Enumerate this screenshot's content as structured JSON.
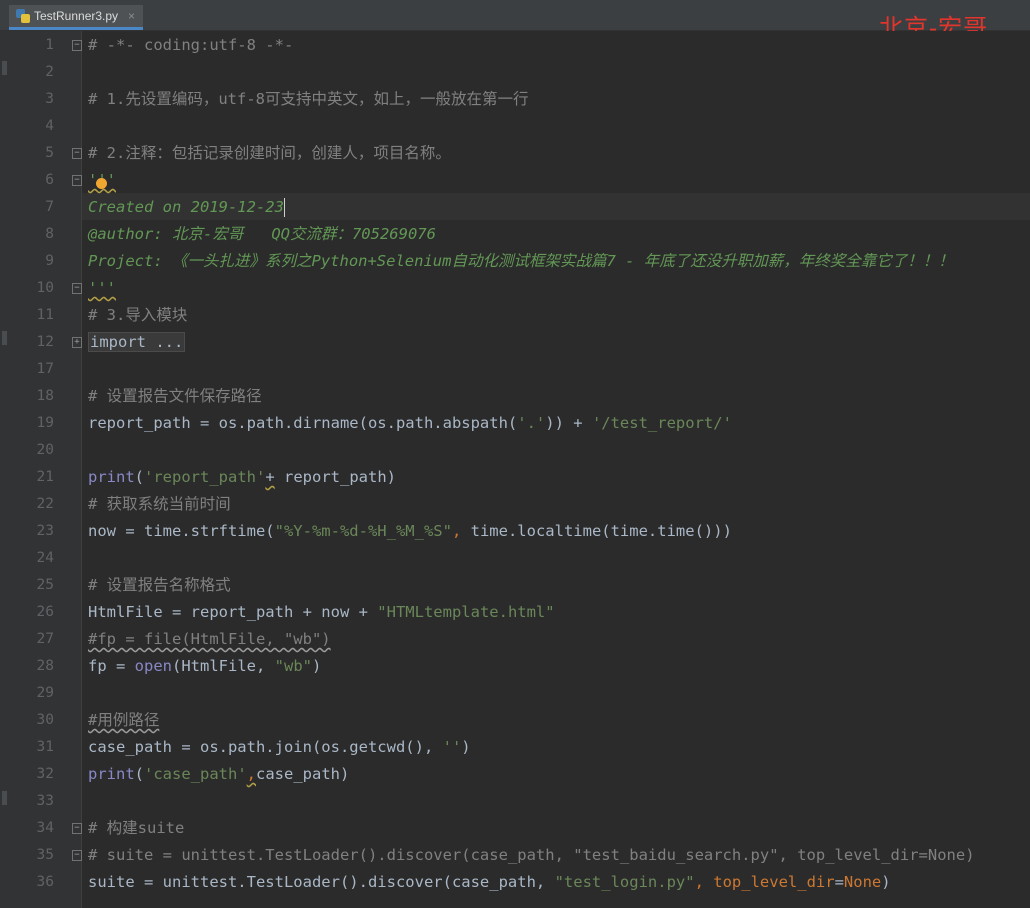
{
  "tab": {
    "filename": "TestRunner3.py",
    "close": "×"
  },
  "watermark": "北京-宏哥",
  "lines": [
    {
      "no": "1",
      "segs": [
        {
          "t": "# -*- coding:utf-8 -*-",
          "c": "cmt"
        }
      ]
    },
    {
      "no": "2",
      "segs": []
    },
    {
      "no": "3",
      "segs": [
        {
          "t": "# 1.先设置编码，utf-8可支持中英文，如上，一般放在第一行",
          "c": "cmt"
        }
      ]
    },
    {
      "no": "4",
      "segs": []
    },
    {
      "no": "5",
      "segs": [
        {
          "t": "# 2.注释：包括记录创建时间，创建人，项目名称。",
          "c": "cmt"
        }
      ]
    },
    {
      "no": "6",
      "segs": [
        {
          "t": "'''",
          "c": "doc squig"
        }
      ]
    },
    {
      "no": "7",
      "segs": [
        {
          "t": "Created on 2019-12-23",
          "c": "doc"
        },
        {
          "caret": true
        }
      ]
    },
    {
      "no": "8",
      "segs": [
        {
          "t": "@author: 北京-宏哥   QQ交流群：705269076",
          "c": "doc"
        }
      ]
    },
    {
      "no": "9",
      "segs": [
        {
          "t": "Project: 《一头扎进》系列之Python+Selenium自动化测试框架实战篇7 - 年底了还没升职加薪，年终奖全靠它了！！！",
          "c": "doc"
        }
      ]
    },
    {
      "no": "10",
      "segs": [
        {
          "t": "'''",
          "c": "doc squig"
        }
      ]
    },
    {
      "no": "11",
      "segs": [
        {
          "t": "# 3.导入模块",
          "c": "cmt"
        }
      ]
    },
    {
      "no": "12",
      "segs": [
        {
          "t": "import ...",
          "c": "folded"
        }
      ]
    },
    {
      "no": "17",
      "segs": []
    },
    {
      "no": "18",
      "segs": [
        {
          "t": "# 设置报告文件保存路径",
          "c": "cmt"
        }
      ]
    },
    {
      "no": "19",
      "segs": [
        {
          "t": "report_path = os.path.dirname(os.path.abspath("
        },
        {
          "t": "'.'",
          "c": "str"
        },
        {
          "t": ")) + "
        },
        {
          "t": "'/test_report/'",
          "c": "str"
        }
      ]
    },
    {
      "no": "20",
      "segs": []
    },
    {
      "no": "21",
      "segs": [
        {
          "t": "print",
          "c": "bi"
        },
        {
          "t": "("
        },
        {
          "t": "'report_path'",
          "c": "str"
        },
        {
          "t": "+",
          "c": "squig"
        },
        {
          "t": " report_path)"
        }
      ]
    },
    {
      "no": "22",
      "segs": [
        {
          "t": "# 获取系统当前时间",
          "c": "cmt"
        }
      ]
    },
    {
      "no": "23",
      "segs": [
        {
          "t": "now = time.strftime("
        },
        {
          "t": "\"%Y-%m-%d-%H_%M_%S\"",
          "c": "str"
        },
        {
          "t": ", ",
          "c": "kw"
        },
        {
          "t": "time.localtime(time.time()))"
        }
      ]
    },
    {
      "no": "24",
      "segs": []
    },
    {
      "no": "25",
      "segs": [
        {
          "t": "# 设置报告名称格式",
          "c": "cmt"
        }
      ]
    },
    {
      "no": "26",
      "segs": [
        {
          "t": "HtmlFile = report_path + now + "
        },
        {
          "t": "\"HTMLtemplate.html\"",
          "c": "str"
        }
      ]
    },
    {
      "no": "27",
      "segs": [
        {
          "t": "#fp = file(HtmlFile, \"wb\")",
          "c": "cmt squig-cmt"
        }
      ]
    },
    {
      "no": "28",
      "segs": [
        {
          "t": "fp = "
        },
        {
          "t": "open",
          "c": "bi"
        },
        {
          "t": "(HtmlFile, "
        },
        {
          "t": "\"wb\"",
          "c": "str"
        },
        {
          "t": ")"
        }
      ]
    },
    {
      "no": "29",
      "segs": []
    },
    {
      "no": "30",
      "segs": [
        {
          "t": "#用例路径",
          "c": "cmt squig-cmt"
        }
      ]
    },
    {
      "no": "31",
      "segs": [
        {
          "t": "case_path = os.path.join(os.getcwd(), "
        },
        {
          "t": "''",
          "c": "str"
        },
        {
          "t": ")"
        }
      ]
    },
    {
      "no": "32",
      "segs": [
        {
          "t": "print",
          "c": "bi"
        },
        {
          "t": "("
        },
        {
          "t": "'case_path'",
          "c": "str"
        },
        {
          "t": ",",
          "c": "kw squig"
        },
        {
          "t": "case_path)"
        }
      ]
    },
    {
      "no": "33",
      "segs": []
    },
    {
      "no": "34",
      "segs": [
        {
          "t": "# 构建suite",
          "c": "cmt"
        }
      ]
    },
    {
      "no": "35",
      "segs": [
        {
          "t": "# suite = unittest.TestLoader().discover(case_path, \"test_baidu_search.py\", top_level_dir=None)",
          "c": "cmt"
        }
      ]
    },
    {
      "no": "36",
      "segs": [
        {
          "t": "suite = unittest.TestLoader().discover(case_path, "
        },
        {
          "t": "\"test_login.py\"",
          "c": "str"
        },
        {
          "t": ", ",
          "c": "kw"
        },
        {
          "t": "top_level_dir",
          "c": "kw"
        },
        {
          "t": "="
        },
        {
          "t": "None",
          "c": "kw"
        },
        {
          "t": ")"
        }
      ]
    }
  ],
  "folds": [
    {
      "line": "1",
      "kind": "start"
    },
    {
      "line": "5",
      "kind": "end"
    },
    {
      "line": "6",
      "kind": "start"
    },
    {
      "line": "10",
      "kind": "end"
    },
    {
      "line": "12",
      "kind": "collapsed"
    },
    {
      "line": "34",
      "kind": "start"
    },
    {
      "line": "35",
      "kind": "end"
    }
  ],
  "current_line": "7",
  "colors": {
    "background": "#2b2b2b",
    "gutter": "#313335",
    "comment": "#808080",
    "string": "#6a8759",
    "docstring": "#629755",
    "keyword": "#cc7832",
    "builtin": "#8888c6",
    "text": "#a9b7c6",
    "watermark": "#e3352c"
  },
  "icons": {
    "tab": "python-file-icon",
    "intention": "lightbulb-icon"
  }
}
